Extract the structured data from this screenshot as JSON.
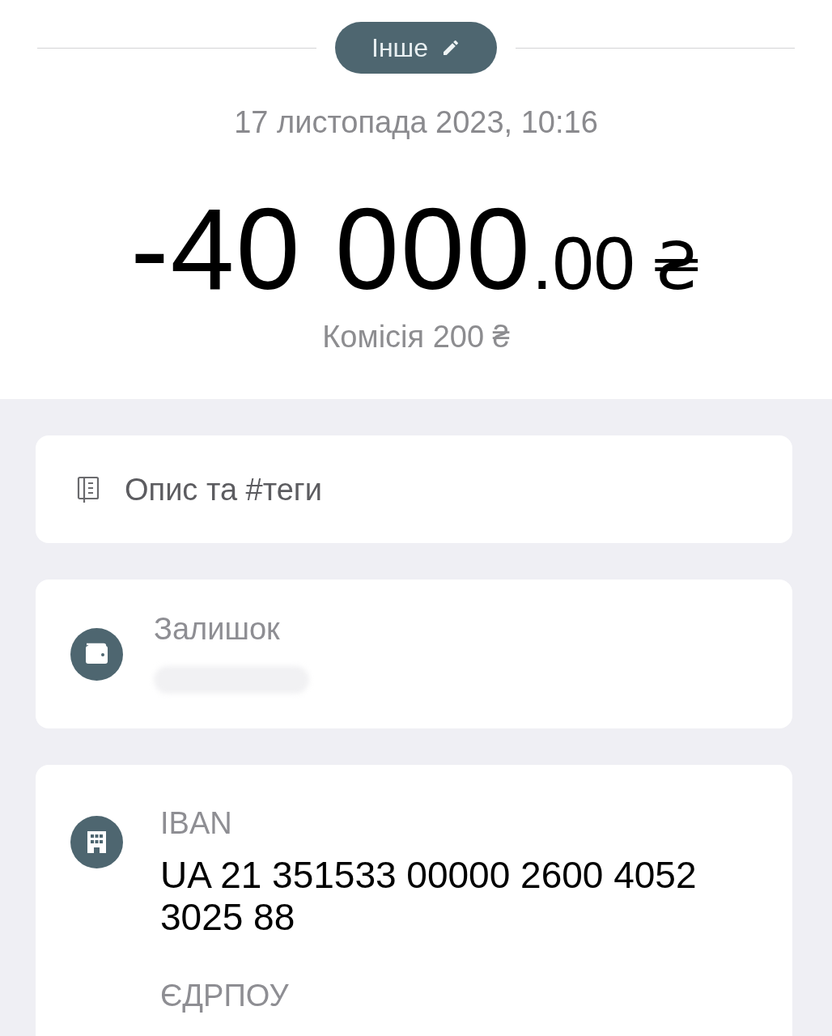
{
  "category_button": {
    "label": "Інше",
    "editable": true
  },
  "datetime": "17 листопада 2023, 10:16",
  "amount": {
    "integer": "-40 000",
    "fraction": ".00",
    "currency": "₴"
  },
  "commission": "Комісія 200 ₴",
  "description_row": {
    "label": "Опис та #теги"
  },
  "balance_card": {
    "label": "Залишок",
    "value_hidden": true
  },
  "details_card": {
    "fields": [
      {
        "label": "IBAN",
        "value": "UA 21 351533 00000 2600 4052 3025 88"
      },
      {
        "label": "ЄДРПОУ"
      }
    ]
  }
}
